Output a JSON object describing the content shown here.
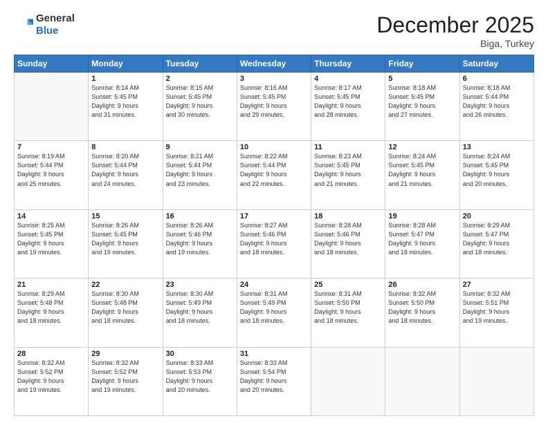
{
  "header": {
    "logo_general": "General",
    "logo_blue": "Blue",
    "month_title": "December 2025",
    "location": "Biga, Turkey"
  },
  "days_of_week": [
    "Sunday",
    "Monday",
    "Tuesday",
    "Wednesday",
    "Thursday",
    "Friday",
    "Saturday"
  ],
  "weeks": [
    [
      {
        "day": "",
        "info": ""
      },
      {
        "day": "1",
        "info": "Sunrise: 8:14 AM\nSunset: 5:45 PM\nDaylight: 9 hours\nand 31 minutes."
      },
      {
        "day": "2",
        "info": "Sunrise: 8:15 AM\nSunset: 5:45 PM\nDaylight: 9 hours\nand 30 minutes."
      },
      {
        "day": "3",
        "info": "Sunrise: 8:16 AM\nSunset: 5:45 PM\nDaylight: 9 hours\nand 29 minutes."
      },
      {
        "day": "4",
        "info": "Sunrise: 8:17 AM\nSunset: 5:45 PM\nDaylight: 9 hours\nand 28 minutes."
      },
      {
        "day": "5",
        "info": "Sunrise: 8:18 AM\nSunset: 5:45 PM\nDaylight: 9 hours\nand 27 minutes."
      },
      {
        "day": "6",
        "info": "Sunrise: 8:18 AM\nSunset: 5:44 PM\nDaylight: 9 hours\nand 26 minutes."
      }
    ],
    [
      {
        "day": "7",
        "info": "Sunrise: 8:19 AM\nSunset: 5:44 PM\nDaylight: 9 hours\nand 25 minutes."
      },
      {
        "day": "8",
        "info": "Sunrise: 8:20 AM\nSunset: 5:44 PM\nDaylight: 9 hours\nand 24 minutes."
      },
      {
        "day": "9",
        "info": "Sunrise: 8:21 AM\nSunset: 5:44 PM\nDaylight: 9 hours\nand 23 minutes."
      },
      {
        "day": "10",
        "info": "Sunrise: 8:22 AM\nSunset: 5:44 PM\nDaylight: 9 hours\nand 22 minutes."
      },
      {
        "day": "11",
        "info": "Sunrise: 8:23 AM\nSunset: 5:45 PM\nDaylight: 9 hours\nand 21 minutes."
      },
      {
        "day": "12",
        "info": "Sunrise: 8:24 AM\nSunset: 5:45 PM\nDaylight: 9 hours\nand 21 minutes."
      },
      {
        "day": "13",
        "info": "Sunrise: 8:24 AM\nSunset: 5:45 PM\nDaylight: 9 hours\nand 20 minutes."
      }
    ],
    [
      {
        "day": "14",
        "info": "Sunrise: 8:25 AM\nSunset: 5:45 PM\nDaylight: 9 hours\nand 19 minutes."
      },
      {
        "day": "15",
        "info": "Sunrise: 8:26 AM\nSunset: 5:45 PM\nDaylight: 9 hours\nand 19 minutes."
      },
      {
        "day": "16",
        "info": "Sunrise: 8:26 AM\nSunset: 5:46 PM\nDaylight: 9 hours\nand 19 minutes."
      },
      {
        "day": "17",
        "info": "Sunrise: 8:27 AM\nSunset: 5:46 PM\nDaylight: 9 hours\nand 18 minutes."
      },
      {
        "day": "18",
        "info": "Sunrise: 8:28 AM\nSunset: 5:46 PM\nDaylight: 9 hours\nand 18 minutes."
      },
      {
        "day": "19",
        "info": "Sunrise: 8:28 AM\nSunset: 5:47 PM\nDaylight: 9 hours\nand 18 minutes."
      },
      {
        "day": "20",
        "info": "Sunrise: 8:29 AM\nSunset: 5:47 PM\nDaylight: 9 hours\nand 18 minutes."
      }
    ],
    [
      {
        "day": "21",
        "info": "Sunrise: 8:29 AM\nSunset: 5:48 PM\nDaylight: 9 hours\nand 18 minutes."
      },
      {
        "day": "22",
        "info": "Sunrise: 8:30 AM\nSunset: 5:48 PM\nDaylight: 9 hours\nand 18 minutes."
      },
      {
        "day": "23",
        "info": "Sunrise: 8:30 AM\nSunset: 5:49 PM\nDaylight: 9 hours\nand 18 minutes."
      },
      {
        "day": "24",
        "info": "Sunrise: 8:31 AM\nSunset: 5:49 PM\nDaylight: 9 hours\nand 18 minutes."
      },
      {
        "day": "25",
        "info": "Sunrise: 8:31 AM\nSunset: 5:50 PM\nDaylight: 9 hours\nand 18 minutes."
      },
      {
        "day": "26",
        "info": "Sunrise: 8:32 AM\nSunset: 5:50 PM\nDaylight: 9 hours\nand 18 minutes."
      },
      {
        "day": "27",
        "info": "Sunrise: 8:32 AM\nSunset: 5:51 PM\nDaylight: 9 hours\nand 19 minutes."
      }
    ],
    [
      {
        "day": "28",
        "info": "Sunrise: 8:32 AM\nSunset: 5:52 PM\nDaylight: 9 hours\nand 19 minutes."
      },
      {
        "day": "29",
        "info": "Sunrise: 8:32 AM\nSunset: 5:52 PM\nDaylight: 9 hours\nand 19 minutes."
      },
      {
        "day": "30",
        "info": "Sunrise: 8:33 AM\nSunset: 5:53 PM\nDaylight: 9 hours\nand 20 minutes."
      },
      {
        "day": "31",
        "info": "Sunrise: 8:33 AM\nSunset: 5:54 PM\nDaylight: 9 hours\nand 20 minutes."
      },
      {
        "day": "",
        "info": ""
      },
      {
        "day": "",
        "info": ""
      },
      {
        "day": "",
        "info": ""
      }
    ]
  ]
}
